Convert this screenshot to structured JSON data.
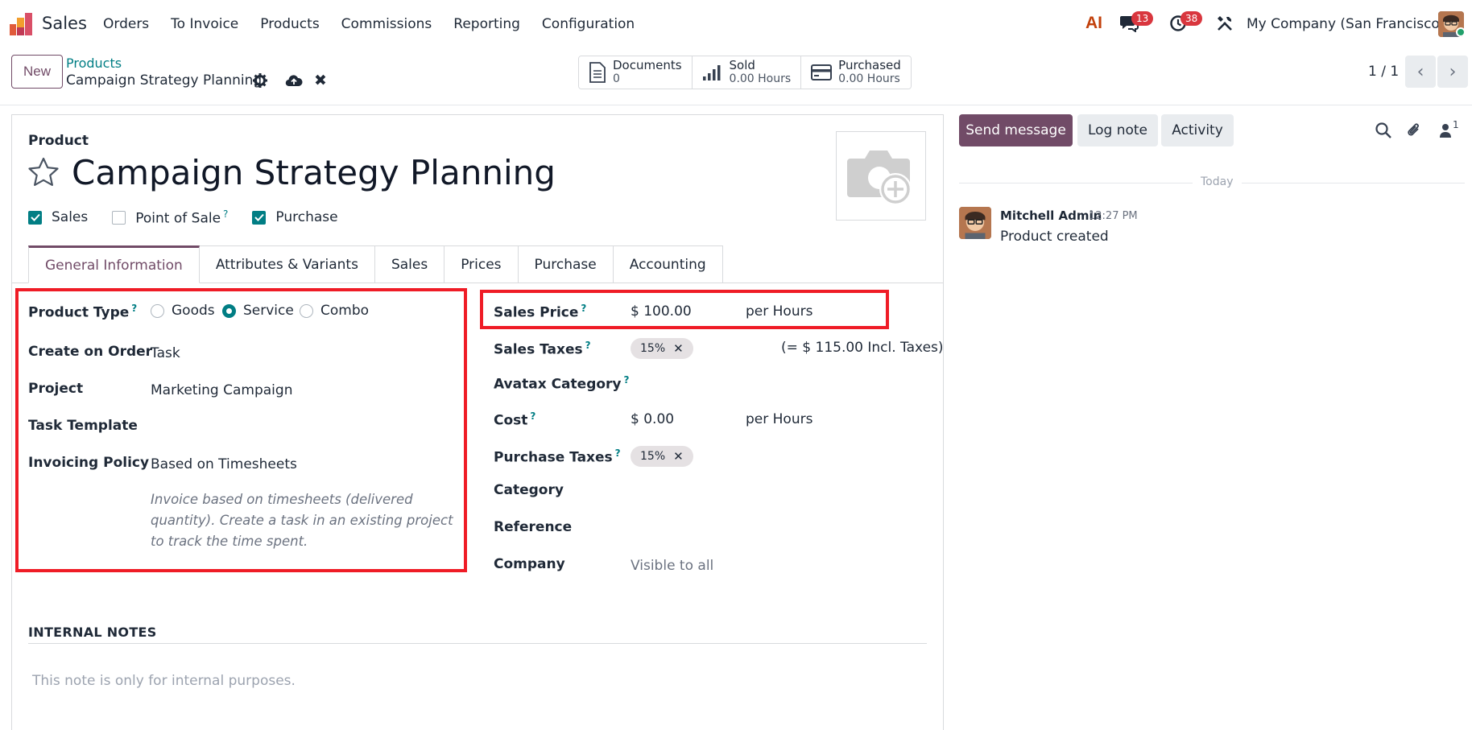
{
  "navbar": {
    "app_name": "Sales",
    "menu": [
      "Orders",
      "To Invoice",
      "Products",
      "Commissions",
      "Reporting",
      "Configuration"
    ],
    "ai_label": "AI",
    "messages_count": "13",
    "activities_count": "38",
    "company": "My Company (San Francisco)"
  },
  "control_panel": {
    "new_label": "New",
    "breadcrumb_parent": "Products",
    "breadcrumb_current": "Campaign Strategy Planning",
    "smart_buttons": [
      {
        "label": "Documents",
        "value": "0",
        "icon": "document-icon"
      },
      {
        "label": "Sold",
        "value": "0.00 Hours",
        "icon": "bar-chart-icon"
      },
      {
        "label": "Purchased",
        "value": "0.00 Hours",
        "icon": "credit-card-icon"
      }
    ],
    "pager": "1 / 1"
  },
  "form": {
    "header_label": "Product",
    "title": "Campaign Strategy Planning",
    "checkboxes": [
      {
        "label": "Sales",
        "checked": true
      },
      {
        "label": "Point of Sale",
        "checked": false,
        "help": "?"
      },
      {
        "label": "Purchase",
        "checked": true
      }
    ],
    "tabs": [
      "General Information",
      "Attributes & Variants",
      "Sales",
      "Prices",
      "Purchase",
      "Accounting"
    ],
    "left_fields": {
      "product_type_label": "Product Type",
      "product_type_options": [
        "Goods",
        "Service",
        "Combo"
      ],
      "product_type_selected": "Service",
      "create_on_order_label": "Create on Order",
      "create_on_order_value": "Task",
      "project_label": "Project",
      "project_value": "Marketing Campaign",
      "task_template_label": "Task Template",
      "invoicing_policy_label": "Invoicing Policy",
      "invoicing_policy_value": "Based on Timesheets",
      "invoicing_note": "Invoice based on timesheets (delivered quantity). Create a task in an existing project to track the time spent."
    },
    "right_fields": {
      "sales_price_label": "Sales Price",
      "sales_price_value": "$ 100.00",
      "sales_price_unit": "per Hours",
      "sales_taxes_label": "Sales Taxes",
      "sales_taxes_tag": "15%",
      "sales_taxes_incl": "(= $ 115.00 Incl. Taxes)",
      "avatax_label": "Avatax Category",
      "cost_label": "Cost",
      "cost_value": "$ 0.00",
      "cost_unit": "per Hours",
      "purchase_taxes_label": "Purchase Taxes",
      "purchase_taxes_tag": "15%",
      "category_label": "Category",
      "reference_label": "Reference",
      "company_label": "Company",
      "company_value": "Visible to all"
    },
    "help_mark": "?",
    "internal_notes_title": "INTERNAL NOTES",
    "internal_notes_placeholder": "This note is only for internal purposes."
  },
  "chatter": {
    "send_message": "Send message",
    "log_note": "Log note",
    "activity": "Activity",
    "followers_count": "1",
    "today": "Today",
    "message": {
      "author": "Mitchell Admin",
      "time": "12:27 PM",
      "body": "Product created"
    }
  },
  "colors": {
    "brand": "#714b67",
    "accent": "#017e84",
    "highlight": "#ef1c26",
    "badge": "#d9363e"
  }
}
